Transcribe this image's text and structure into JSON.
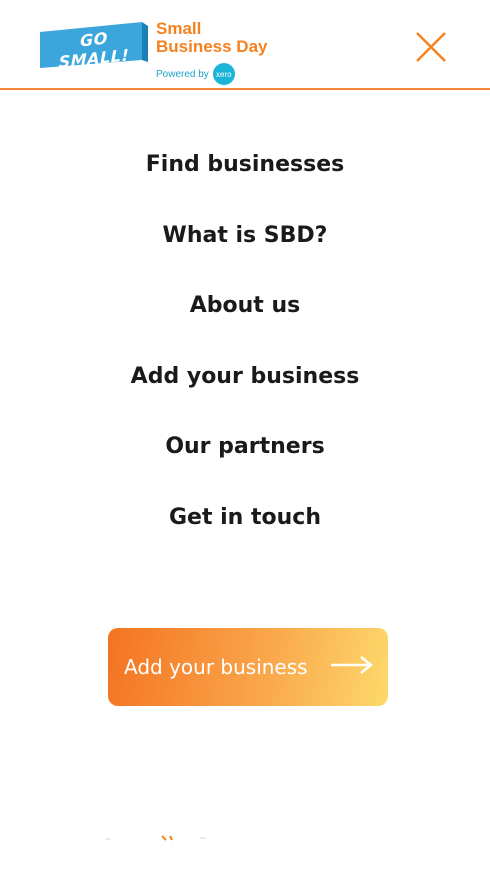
{
  "header": {
    "logo_flag_text": "GO SMALL!",
    "brand_line1": "Small",
    "brand_line2": "Business Day",
    "powered_by": "Powered by",
    "powered_badge": "xero",
    "close_icon": "close-icon"
  },
  "nav": {
    "items": [
      {
        "label": "Find businesses"
      },
      {
        "label": "What is SBD?"
      },
      {
        "label": "About us"
      },
      {
        "label": "Add your business"
      },
      {
        "label": "Our partners"
      },
      {
        "label": "Get in touch"
      }
    ]
  },
  "cta": {
    "label": "Add your business",
    "icon": "arrow-right-icon"
  },
  "colors": {
    "accent": "#f58220",
    "brand_blue": "#1aa3c9",
    "text": "#1a1a1a"
  }
}
